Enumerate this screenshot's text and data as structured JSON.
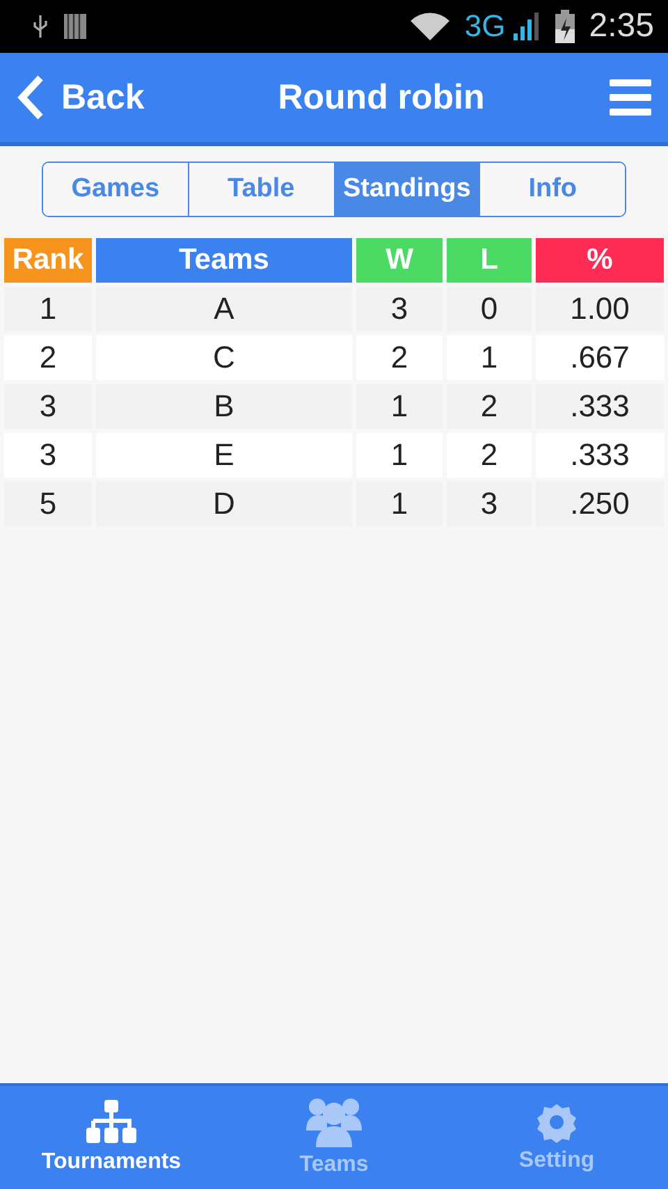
{
  "status_bar": {
    "network": "3G",
    "time": "2:35"
  },
  "header": {
    "back": "Back",
    "title": "Round robin"
  },
  "tabs": [
    {
      "label": "Games",
      "selected": false
    },
    {
      "label": "Table",
      "selected": false
    },
    {
      "label": "Standings",
      "selected": true
    },
    {
      "label": "Info",
      "selected": false
    }
  ],
  "table": {
    "columns": [
      {
        "label": "Rank",
        "color": "#f7941d"
      },
      {
        "label": "Teams",
        "color": "#3b82f0"
      },
      {
        "label": "W",
        "color": "#4cd964"
      },
      {
        "label": "L",
        "color": "#4cd964"
      },
      {
        "label": "%",
        "color": "#ff2d55"
      }
    ],
    "rows": [
      [
        "1",
        "A",
        "3",
        "0",
        "1.00"
      ],
      [
        "2",
        "C",
        "2",
        "1",
        ".667"
      ],
      [
        "3",
        "B",
        "1",
        "2",
        ".333"
      ],
      [
        "3",
        "E",
        "1",
        "2",
        ".333"
      ],
      [
        "5",
        "D",
        "1",
        "3",
        ".250"
      ]
    ]
  },
  "bottom_nav": [
    {
      "label": "Tournaments",
      "kind": "bracket",
      "selected": true
    },
    {
      "label": "Teams",
      "kind": "people",
      "selected": false
    },
    {
      "label": "Setting",
      "kind": "gear",
      "selected": false
    }
  ]
}
